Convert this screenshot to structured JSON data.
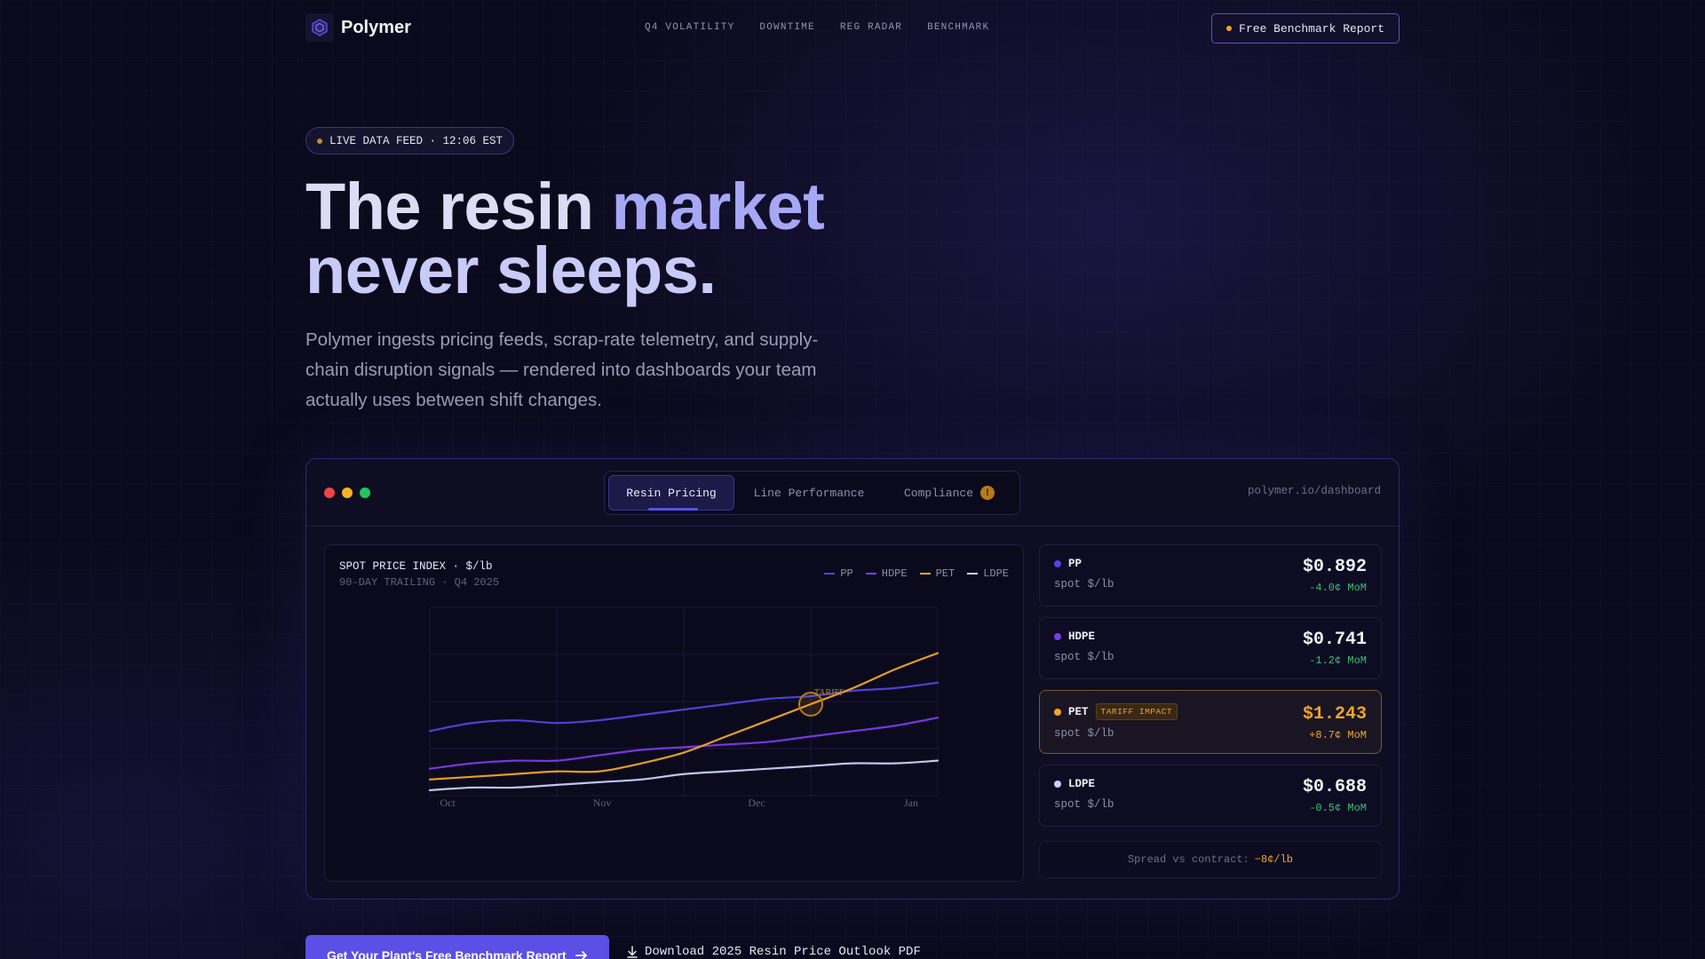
{
  "brand": {
    "name": "Polymer",
    "logo_icon": "hexagon-logo-icon"
  },
  "nav": {
    "links": [
      "Q4 VOLATILITY",
      "DOWNTIME",
      "REG RADAR",
      "BENCHMARK"
    ],
    "cta_label": "Free Benchmark Report"
  },
  "hero": {
    "badge": "LIVE DATA FEED · 12:06 EST",
    "title_part1": "The resin ",
    "title_accent": "market",
    "title_line2": "never sleeps.",
    "subtitle": "Polymer ingests pricing feeds, scrap-rate telemetry, and supply-chain disruption signals — rendered into dashboards your team actually uses between shift changes."
  },
  "dashboard": {
    "tabs": [
      {
        "label": "Resin Pricing",
        "active": true
      },
      {
        "label": "Line Performance",
        "active": false
      },
      {
        "label": "Compliance",
        "active": false,
        "badge": "!"
      }
    ],
    "url": "polymer.io/dashboard",
    "chart_title": "SPOT PRICE INDEX · $/lb",
    "chart_subtitle": "90-DAY TRAILING · Q4 2025",
    "annotation": "TARIFF",
    "cards": [
      {
        "name": "PP",
        "unit": "spot $/lb",
        "price": "$0.892",
        "change": "-4.0¢ MoM",
        "color": "#4f46e5"
      },
      {
        "name": "HDPE",
        "unit": "spot $/lb",
        "price": "$0.741",
        "change": "-1.2¢ MoM",
        "color": "#7c3aed"
      },
      {
        "name": "PET",
        "tag": "TARIFF IMPACT",
        "unit": "spot $/lb",
        "price": "$1.243",
        "change": "+8.7¢ MoM",
        "color": "#f5a524"
      },
      {
        "name": "LDPE",
        "unit": "spot $/lb",
        "price": "$0.688",
        "change": "-0.5¢ MoM",
        "color": "#c7d2fe"
      }
    ],
    "spread_label": "Spread vs contract:",
    "spread_value": "−8¢/lb"
  },
  "ctas": {
    "primary": "Get Your Plant's Free Benchmark Report",
    "secondary": "Download 2025 Resin Price Outlook PDF"
  },
  "chart_data": {
    "type": "line",
    "x_ticks": [
      "Oct",
      "Nov",
      "Dec",
      "Jan"
    ],
    "x": [
      0,
      1,
      2,
      3,
      4,
      5,
      6,
      7,
      8,
      9,
      10,
      11,
      12
    ],
    "ylim": [
      0.6,
      1.3
    ],
    "series": [
      {
        "name": "PP",
        "color": "#4f46e5",
        "values": [
          0.84,
          0.87,
          0.88,
          0.87,
          0.88,
          0.9,
          0.92,
          0.94,
          0.96,
          0.97,
          0.99,
          1.0,
          1.02
        ]
      },
      {
        "name": "HDPE",
        "color": "#7c3aed",
        "values": [
          0.7,
          0.72,
          0.73,
          0.73,
          0.75,
          0.77,
          0.78,
          0.79,
          0.8,
          0.82,
          0.84,
          0.86,
          0.89
        ]
      },
      {
        "name": "PET",
        "color": "#f5a524",
        "values": [
          0.66,
          0.67,
          0.68,
          0.69,
          0.69,
          0.72,
          0.76,
          0.82,
          0.88,
          0.94,
          1.0,
          1.07,
          1.13
        ]
      },
      {
        "name": "LDPE",
        "color": "#c7d2fe",
        "values": [
          0.62,
          0.63,
          0.63,
          0.64,
          0.65,
          0.66,
          0.68,
          0.69,
          0.7,
          0.71,
          0.72,
          0.72,
          0.73
        ]
      }
    ],
    "annotation_point": {
      "series": "PET",
      "x": 9
    },
    "grid": true,
    "legend_position": "top-right"
  }
}
